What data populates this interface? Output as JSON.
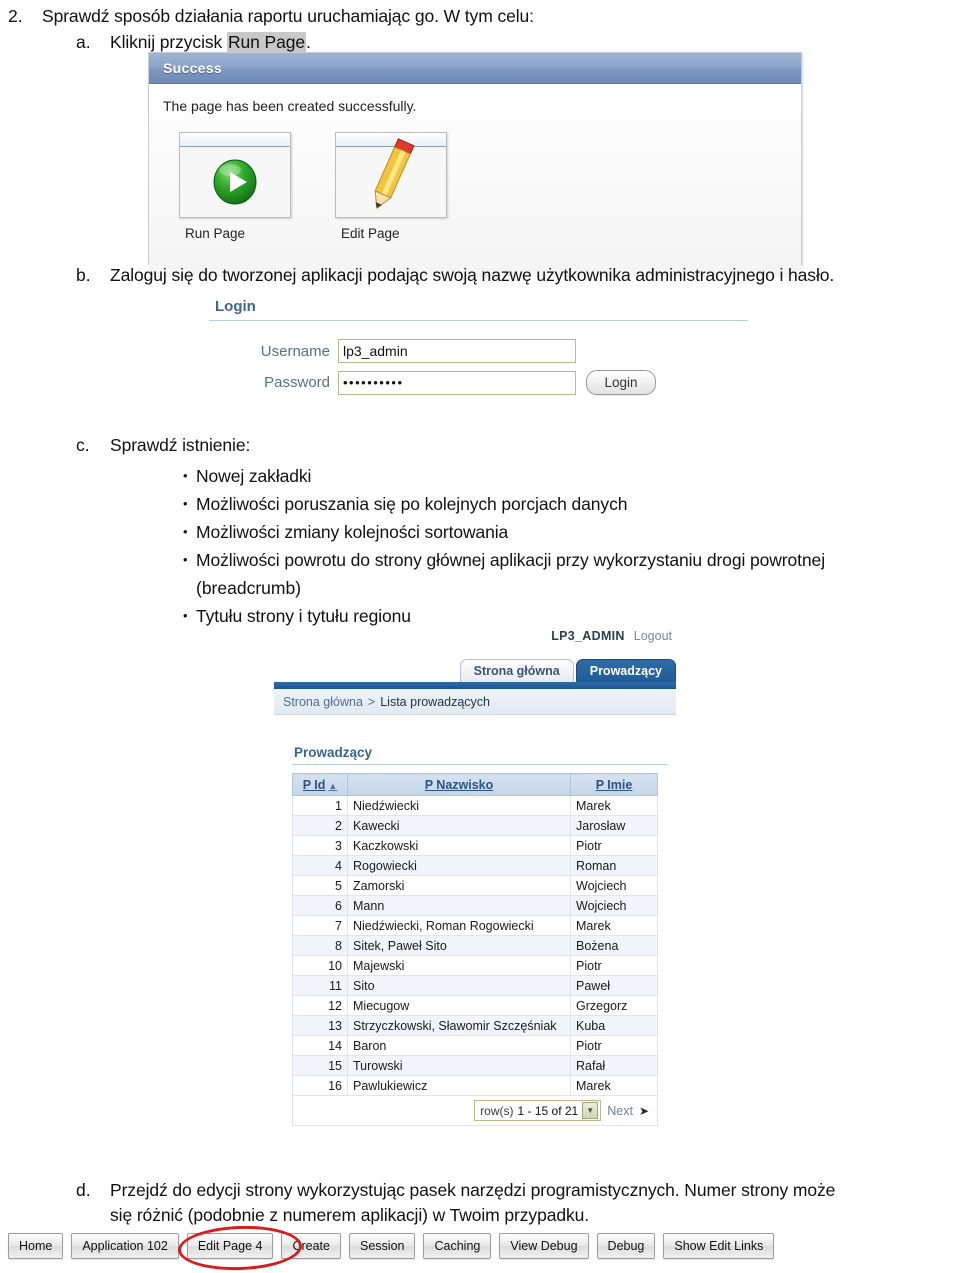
{
  "document": {
    "item2": {
      "marker": "2.",
      "text": "Sprawdź sposób działania raportu uruchamiając go. W tym celu:"
    },
    "item_a": {
      "marker": "a.",
      "text_before": "Kliknij przycisk ",
      "highlight": "Run Page",
      "text_after": "."
    },
    "item_b": {
      "marker": "b.",
      "text": "Zaloguj się do tworzonej aplikacji podając swoją nazwę użytkownika administracyjnego i hasło."
    },
    "item_c": {
      "marker": "c.",
      "text": "Sprawdź istnienie:",
      "bullets": [
        {
          "text": "Nowej zakładki",
          "cont": ""
        },
        {
          "text": "Możliwości poruszania się po kolejnych porcjach danych",
          "cont": ""
        },
        {
          "text": "Możliwości zmiany kolejności sortowania",
          "cont": ""
        },
        {
          "text": "Możliwości powrotu do strony głównej aplikacji przy wykorzystaniu drogi powrotnej",
          "cont": "(breadcrumb)"
        },
        {
          "text": "Tytułu strony i tytułu regionu",
          "cont": ""
        }
      ]
    },
    "item_d": {
      "marker": "d.",
      "line1": "Przejdź do edycji strony wykorzystując pasek narzędzi programistycznych. Numer strony może",
      "line2": "się różnić (podobnie z numerem aplikacji) w Twoim przypadku."
    }
  },
  "success_screenshot": {
    "region_title": "Success",
    "message": "The page has been created successfully.",
    "icons": [
      {
        "name": "run-page",
        "caption": "Run Page",
        "glyph": "play-circle-icon"
      },
      {
        "name": "edit-page",
        "caption": "Edit Page",
        "glyph": "pencil-icon"
      }
    ]
  },
  "login_screenshot": {
    "region_title": "Login",
    "username_label": "Username",
    "username_value": "lp3_admin",
    "password_label": "Password",
    "password_value": "••••••••••",
    "login_button": "Login"
  },
  "app_screenshot": {
    "user": "LP3_ADMIN",
    "logout": "Logout",
    "tabs": [
      {
        "label": "Strona główna",
        "active": false
      },
      {
        "label": "Prowadzący",
        "active": true
      }
    ],
    "breadcrumb": {
      "home": "Strona główna",
      "separator": ">",
      "current": "Lista prowadzących"
    },
    "report": {
      "title": "Prowadzący",
      "columns": [
        "P Id",
        "P Nazwisko",
        "P Imie"
      ],
      "sort_column": "P Id",
      "sort_direction_icon": "sort-asc-icon",
      "rows": [
        [
          "1",
          "Niedźwiecki",
          "Marek"
        ],
        [
          "2",
          "Kawecki",
          "Jarosław"
        ],
        [
          "3",
          "Kaczkowski",
          "Piotr"
        ],
        [
          "4",
          "Rogowiecki",
          "Roman"
        ],
        [
          "5",
          "Zamorski",
          "Wojciech"
        ],
        [
          "6",
          "Mann",
          "Wojciech"
        ],
        [
          "7",
          "Niedźwiecki, Roman Rogowiecki",
          "Marek"
        ],
        [
          "8",
          "Sitek, Paweł Sito",
          "Bożena"
        ],
        [
          "10",
          "Majewski",
          "Piotr"
        ],
        [
          "11",
          "Sito",
          "Paweł"
        ],
        [
          "12",
          "Miecugow",
          "Grzegorz"
        ],
        [
          "13",
          "Strzyczkowski, Sławomir Szczęśniak",
          "Kuba"
        ],
        [
          "14",
          "Baron",
          "Piotr"
        ],
        [
          "15",
          "Turowski",
          "Rafał"
        ],
        [
          "16",
          "Pawlukiewicz",
          "Marek"
        ]
      ],
      "pager": {
        "rows_label": "row(s)",
        "range": "1 - 15 of 21",
        "next_label": "Next",
        "next_icon": "chevron-right-icon",
        "select_icon": "chevron-down-icon"
      }
    }
  },
  "dev_toolbar": {
    "buttons": [
      {
        "label": "Home",
        "highlighted": false
      },
      {
        "label": "Application 102",
        "highlighted": false
      },
      {
        "label": "Edit Page 4",
        "highlighted": true
      },
      {
        "label": "Create",
        "highlighted": false
      },
      {
        "label": "Session",
        "highlighted": false
      },
      {
        "label": "Caching",
        "highlighted": false
      },
      {
        "label": "View Debug",
        "highlighted": false
      },
      {
        "label": "Debug",
        "highlighted": false
      },
      {
        "label": "Show Edit Links",
        "highlighted": false
      }
    ],
    "annotation": "red-ellipse-highlight"
  },
  "colors": {
    "apex_blue": "#1f5b97",
    "region_title_blue": "#3c6291",
    "table_header": "#c5d6ea",
    "highlight_red": "#d81c1c",
    "text_highlight_gray": "#c8c8c8"
  }
}
